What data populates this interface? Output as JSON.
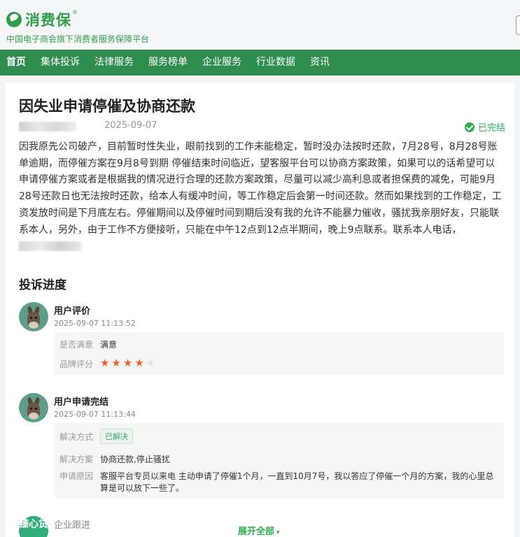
{
  "brand": {
    "name": "消费保",
    "reg_mark": "®",
    "slogan": "中国电子商会旗下消费者服务保障平台"
  },
  "nav": {
    "items": [
      "首页",
      "集体投诉",
      "法律服务",
      "服务榜单",
      "企业服务",
      "行业数据",
      "资讯"
    ],
    "active_index": 0
  },
  "complaint": {
    "title": "因失业申请停催及协商还款",
    "date": "2025-09-07",
    "status": "已完结",
    "body": "因我原先公司破产，目前暂时性失业，眼前找到的工作未能稳定，暂时没办法按时还款，7月28号，8月28号账单逾期，而停催方案在9月8号到期 停催结束时间临近，望客服平台可以协商方案政策，如果可以的话希望可以申请停催方案或者是根据我的情况进行合理的还款方案政策，尽量可以减少高利息或者担保费的减免，可能9月28号还款日也无法按时还款，给本人有缓冲时间，等工作稳定后会第一时间还款。然而如果找到的工作稳定，工资发放时间是下月底左右。停催期间以及停催时间到期后没有我的允许不能暴力催收，骚扰我亲朋好友，只能联系本人，另外，由于工作不方便接听，只能在中午12点到12点半期间，晚上9点联系。联系本人电话，"
  },
  "progress": {
    "section_title": "投诉进度",
    "items": [
      {
        "title": "用户评价",
        "time": "2025-09-07 11:13:52",
        "satisfied_label": "是否满意",
        "satisfied_value": "满意",
        "rating_label": "品牌评分",
        "rating": 4,
        "rating_max": 5
      },
      {
        "title": "用户申请完结",
        "time": "2025-09-07 11:13:44",
        "method_label": "解决方式",
        "method_value": "已解决",
        "plan_label": "解决方案",
        "plan_value": "协商还款,停止骚扰",
        "reason_label": "申请原因",
        "reason_value": "客服平台专员以来电 主动申请了停催1个月，一直到10月7号，我以答应了停催一个月的方案，我的心里总算是可以放下一些了。"
      }
    ],
    "corp": {
      "avatar_text": "臻心贷",
      "label": "企业跟进",
      "expand_label": "展开全部",
      "expand_icon": "▾"
    }
  },
  "colors": {
    "brand_green": "#2f9e4a",
    "nav_bg": "#2d8c4e",
    "status_green": "#2fae4f",
    "star": "#f1622a"
  }
}
